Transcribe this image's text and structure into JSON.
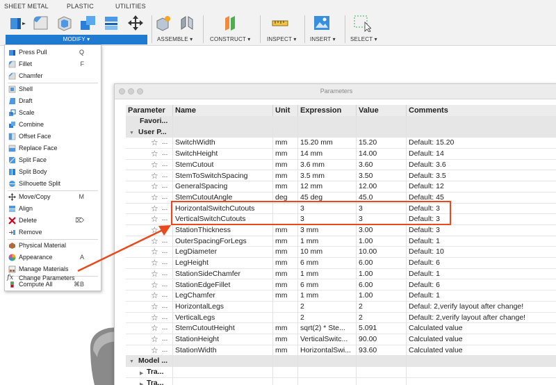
{
  "tabs": [
    "SHEET METAL",
    "PLASTIC",
    "UTILITIES"
  ],
  "groups": {
    "modify": "MODIFY ▾",
    "assemble": "ASSEMBLE ▾",
    "construct": "CONSTRUCT ▾",
    "inspect": "INSPECT ▾",
    "insert": "INSERT ▾",
    "select": "SELECT ▾"
  },
  "menu": {
    "items": [
      {
        "label": "Press Pull",
        "shortcut": "Q",
        "icon": "press-pull-icon"
      },
      {
        "label": "Fillet",
        "shortcut": "F",
        "icon": "fillet-icon"
      },
      {
        "label": "Chamfer",
        "shortcut": "",
        "icon": "chamfer-icon"
      },
      {
        "label": "Shell",
        "shortcut": "",
        "icon": "shell-icon"
      },
      {
        "label": "Draft",
        "shortcut": "",
        "icon": "draft-icon"
      },
      {
        "label": "Scale",
        "shortcut": "",
        "icon": "scale-icon"
      },
      {
        "label": "Combine",
        "shortcut": "",
        "icon": "combine-icon"
      },
      {
        "label": "Offset Face",
        "shortcut": "",
        "icon": "offset-face-icon"
      },
      {
        "label": "Replace Face",
        "shortcut": "",
        "icon": "replace-face-icon"
      },
      {
        "label": "Split Face",
        "shortcut": "",
        "icon": "split-face-icon"
      },
      {
        "label": "Split Body",
        "shortcut": "",
        "icon": "split-body-icon"
      },
      {
        "label": "Silhouette Split",
        "shortcut": "",
        "icon": "silhouette-split-icon"
      },
      {
        "label": "Move/Copy",
        "shortcut": "M",
        "icon": "move-icon"
      },
      {
        "label": "Align",
        "shortcut": "",
        "icon": "align-icon"
      },
      {
        "label": "Delete",
        "shortcut": "⌦",
        "icon": "delete-icon"
      },
      {
        "label": "Remove",
        "shortcut": "",
        "icon": "remove-icon"
      },
      {
        "label": "Physical Material",
        "shortcut": "",
        "icon": "physical-material-icon"
      },
      {
        "label": "Appearance",
        "shortcut": "A",
        "icon": "appearance-icon"
      },
      {
        "label": "Manage Materials",
        "shortcut": "",
        "icon": "manage-materials-icon"
      },
      {
        "label": "Change Parameters",
        "shortcut": "",
        "icon": "fx-icon",
        "icon_glyph": "fx"
      },
      {
        "label": "Compute All",
        "shortcut": "⌘B",
        "icon": "compute-all-icon"
      }
    ]
  },
  "window": {
    "title": "Parameters",
    "columns": [
      "Parameter",
      "Name",
      "Unit",
      "Expression",
      "Value",
      "Comments"
    ],
    "group_favorites": "Favori...",
    "group_user": "User P...",
    "group_model": "Model ...",
    "row_ellipsis": "...",
    "sub_model": [
      "Tra...",
      "Tra..."
    ],
    "rows": [
      {
        "name": "SwitchWidth",
        "unit": "mm",
        "expression": "15.20 mm",
        "value": "15.20",
        "comment": "Default: 15.20"
      },
      {
        "name": "SwitchHeight",
        "unit": "mm",
        "expression": "14 mm",
        "value": "14.00",
        "comment": "Default: 14"
      },
      {
        "name": "StemCutout",
        "unit": "mm",
        "expression": "3.6 mm",
        "value": "3.60",
        "comment": "Default: 3.6"
      },
      {
        "name": "StemToSwitchSpacing",
        "unit": "mm",
        "expression": "3.5 mm",
        "value": "3.50",
        "comment": "Default: 3.5"
      },
      {
        "name": "GeneralSpacing",
        "unit": "mm",
        "expression": "12 mm",
        "value": "12.00",
        "comment": "Default: 12"
      },
      {
        "name": "StemCutoutAngle",
        "unit": "deg",
        "expression": "45 deg",
        "value": "45.0",
        "comment": "Default: 45"
      },
      {
        "name": "HorizontalSwitchCutouts",
        "unit": "",
        "expression": "3",
        "value": "3",
        "comment": "Default: 3"
      },
      {
        "name": "VerticalSwitchCutouts",
        "unit": "",
        "expression": "3",
        "value": "3",
        "comment": "Default: 3"
      },
      {
        "name": "StationThickness",
        "unit": "mm",
        "expression": "3 mm",
        "value": "3.00",
        "comment": "Default: 3"
      },
      {
        "name": "OuterSpacingForLegs",
        "unit": "mm",
        "expression": "1 mm",
        "value": "1.00",
        "comment": "Default: 1"
      },
      {
        "name": "LegDiameter",
        "unit": "mm",
        "expression": "10 mm",
        "value": "10.00",
        "comment": "Default: 10"
      },
      {
        "name": "LegHeight",
        "unit": "mm",
        "expression": "6 mm",
        "value": "6.00",
        "comment": "Default: 6"
      },
      {
        "name": "StationSideChamfer",
        "unit": "mm",
        "expression": "1 mm",
        "value": "1.00",
        "comment": "Default: 1"
      },
      {
        "name": "StationEdgeFillet",
        "unit": "mm",
        "expression": "6 mm",
        "value": "6.00",
        "comment": "Default: 6"
      },
      {
        "name": "LegChamfer",
        "unit": "mm",
        "expression": "1 mm",
        "value": "1.00",
        "comment": "Default: 1"
      },
      {
        "name": "HorizontalLegs",
        "unit": "",
        "expression": "2",
        "value": "2",
        "comment": "Defaul: 2,verify layout after change!"
      },
      {
        "name": "VerticalLegs",
        "unit": "",
        "expression": "2",
        "value": "2",
        "comment": "Default: 2,verify layout after change!"
      },
      {
        "name": "StemCutoutHeight",
        "unit": "mm",
        "expression": "sqrt(2) * Ste...",
        "value": "5.091",
        "comment": "Calculated value"
      },
      {
        "name": "StationHeight",
        "unit": "mm",
        "expression": "VerticalSwitc...",
        "value": "90.00",
        "comment": "Calculated value"
      },
      {
        "name": "StationWidth",
        "unit": "mm",
        "expression": "HorizontalSwi...",
        "value": "93.60",
        "comment": "Calculated value"
      }
    ]
  },
  "colors": {
    "accent": "#1f7bd1",
    "highlight": "#e8491d"
  }
}
